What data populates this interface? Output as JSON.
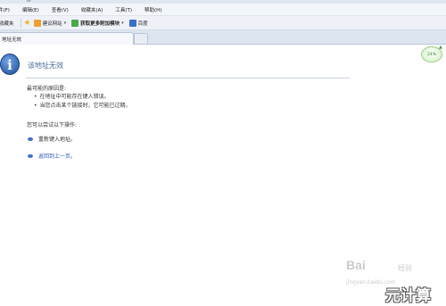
{
  "chrome": {
    "top_fragment": "ie",
    "menu": [
      "件(F)",
      "编辑(E)",
      "查看(V)",
      "收藏夹(A)",
      "工具(T)",
      "帮助(H)"
    ],
    "favorites": {
      "label": "收藏夹",
      "items": [
        {
          "label": "建议网站",
          "icon": "suggested-sites-icon",
          "color": "#f0a030"
        },
        {
          "label": "获取更多附加模块",
          "icon": "addons-icon",
          "color": "#4aa84a"
        },
        {
          "label": "百度",
          "icon": "baidu-icon",
          "color": "#3b6fc9"
        }
      ]
    },
    "tab_title": "地址无效",
    "zoom": "24%"
  },
  "page": {
    "title": "该地址无效",
    "reasons_heading": "最可能的原因是:",
    "reasons": [
      "在地址中可能存在键入错误。",
      "当您点击某个链接时，它可能已过期。"
    ],
    "try_heading": "您可以尝试以下操作:",
    "actions": [
      "重新键入地址。",
      "返回到上一页。"
    ]
  },
  "watermark": {
    "brand": "Bai",
    "brand_sub": "经验",
    "url": "jingyan.baidu.com",
    "overlay": "元计算"
  }
}
